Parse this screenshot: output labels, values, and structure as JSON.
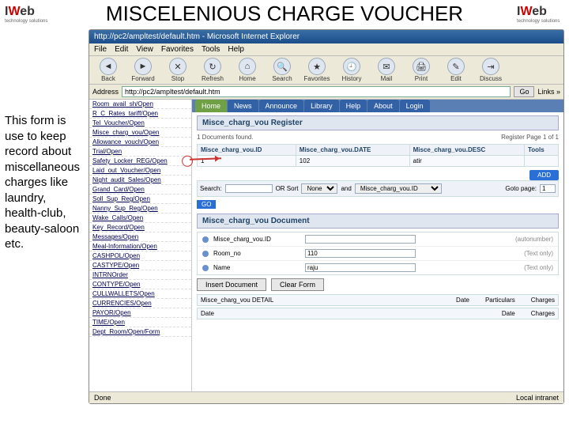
{
  "slide": {
    "title": "MISCELENIOUS CHARGE VOUCHER",
    "caption": "This form is use to keep record about miscellaneous charges like laundry, health-club, beauty-saloon etc.",
    "logo_text": "Web",
    "logo_sub": "technology solutions"
  },
  "browser": {
    "title": "http://pc2/ampltest/default.htm - Microsoft Internet Explorer",
    "address_label": "Address",
    "address_value": "http://pc2/ampltest/default.htm",
    "go": "Go",
    "links": "Links »",
    "status_left": "Done",
    "status_right": "Local intranet",
    "menu": [
      "File",
      "Edit",
      "View",
      "Favorites",
      "Tools",
      "Help"
    ],
    "toolbar": [
      {
        "icon": "◄",
        "label": "Back"
      },
      {
        "icon": "►",
        "label": "Forward"
      },
      {
        "icon": "✕",
        "label": "Stop"
      },
      {
        "icon": "↻",
        "label": "Refresh"
      },
      {
        "icon": "⌂",
        "label": "Home"
      },
      {
        "icon": "🔍",
        "label": "Search"
      },
      {
        "icon": "★",
        "label": "Favorites"
      },
      {
        "icon": "🕘",
        "label": "History"
      },
      {
        "icon": "✉",
        "label": "Mail"
      },
      {
        "icon": "🖨",
        "label": "Print"
      },
      {
        "icon": "✎",
        "label": "Edit"
      },
      {
        "icon": "⇥",
        "label": "Discuss"
      }
    ]
  },
  "sidebar": {
    "items": [
      "Room_avail_sh/Open",
      "R_C_Rates_tariff/Open",
      "Tel_Voucher/Open",
      "Misce_charg_vou/Open",
      "Allowance_vouch/Open",
      "Trial/Open",
      "Safety_Locker_REG/Open",
      "Laid_out_Voucher/Open",
      "Night_audit_Sales/Open",
      "Grand_Card/Open",
      "Soll_Sup_Reg/Open",
      "Nanny_Sup_Reg/Open",
      "Wake_Calls/Open",
      "Key_Record/Open",
      "Messages/Open",
      "Meal-Information/Open",
      "CASHPOL/Open",
      "CASTYPE/Open",
      "INTRNOrder",
      "CONTYPE/Open",
      "CULLWALLETS/Open",
      "CURRENCIES/Open",
      "PAYOR/Open",
      "TIME/Open",
      "Dept_Room/Open/Form"
    ]
  },
  "tabs": [
    "Home",
    "News",
    "Announce",
    "Library",
    "Help",
    "About",
    "Login"
  ],
  "register": {
    "title": "Misce_charg_vou Register",
    "found": "1 Documents found.",
    "page_info": "Register Page 1 of 1",
    "cols": [
      "Misce_charg_vou.ID",
      "Misce_charg_vou.DATE",
      "Misce_charg_vou.DESC",
      "Tools"
    ],
    "row": [
      "1",
      "102",
      "atir",
      ""
    ],
    "add": "ADD"
  },
  "searchbar": {
    "label": "Search:",
    "or_sort": "OR Sort",
    "sort_sel": "None",
    "and_sel": "Misce_charg_vou.ID",
    "goto": "Goto page:",
    "goto_val": "1",
    "go": "GO"
  },
  "doc": {
    "title": "Misce_charg_vou Document",
    "fields": [
      {
        "label": "Misce_charg_vou.ID",
        "value": "",
        "hint": "(autonumber)"
      },
      {
        "label": "Room_no",
        "value": "110",
        "hint": "(Text only)"
      },
      {
        "label": "Name",
        "value": "raju",
        "hint": "(Text only)"
      }
    ],
    "insert": "Insert Document",
    "clear": "Clear Form"
  },
  "detail": {
    "left_title": "Misce_charg_vou DETAIL",
    "cols1": [
      "Date",
      "Particulars",
      "Charges"
    ],
    "row_l": "Date",
    "row_r": [
      "Date",
      "Charges"
    ]
  }
}
